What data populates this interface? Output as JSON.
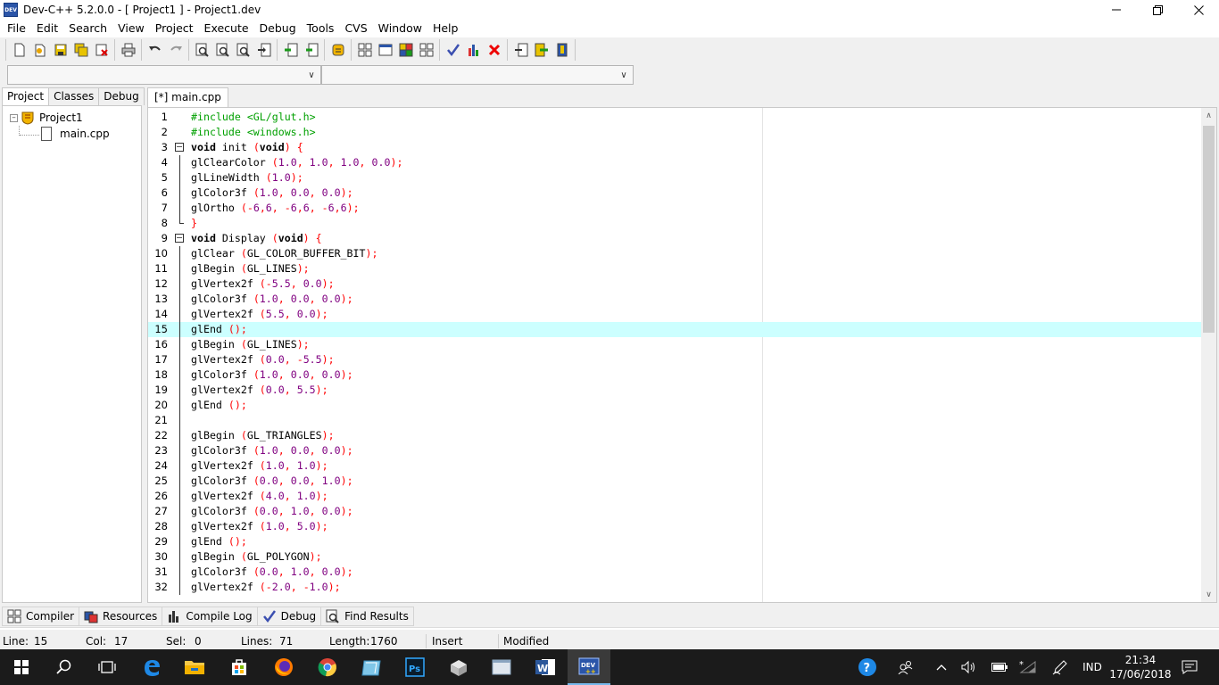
{
  "window": {
    "title": "Dev-C++ 5.2.0.0 - [ Project1 ] - Project1.dev",
    "app_icon_text": "DEV"
  },
  "menu": [
    "File",
    "Edit",
    "Search",
    "View",
    "Project",
    "Execute",
    "Debug",
    "Tools",
    "CVS",
    "Window",
    "Help"
  ],
  "left_panel": {
    "tabs": [
      "Project",
      "Classes",
      "Debug"
    ],
    "active_tab": "Project",
    "tree": {
      "project": "Project1",
      "files": [
        "main.cpp"
      ]
    }
  },
  "editor": {
    "tab_label": "[*] main.cpp",
    "current_line": 15,
    "lines": [
      {
        "n": "1",
        "text": "#include <GL/glut.h>"
      },
      {
        "n": "2",
        "text": "#include <windows.h>"
      },
      {
        "n": "3",
        "text": "void init (void) {"
      },
      {
        "n": "4",
        "text": "glClearColor (1.0, 1.0, 1.0, 0.0);"
      },
      {
        "n": "5",
        "text": "glLineWidth (1.0);"
      },
      {
        "n": "6",
        "text": "glColor3f (1.0, 0.0, 0.0);"
      },
      {
        "n": "7",
        "text": "glOrtho (-6,6, -6,6, -6,6);"
      },
      {
        "n": "8",
        "text": "}"
      },
      {
        "n": "9",
        "text": "void Display (void) {"
      },
      {
        "n": "10",
        "text": "glClear (GL_COLOR_BUFFER_BIT);"
      },
      {
        "n": "11",
        "text": "glBegin (GL_LINES);"
      },
      {
        "n": "12",
        "text": "glVertex2f (-5.5, 0.0);"
      },
      {
        "n": "13",
        "text": "glColor3f (1.0, 0.0, 0.0);"
      },
      {
        "n": "14",
        "text": "glVertex2f (5.5, 0.0);"
      },
      {
        "n": "15",
        "text": "glEnd ();"
      },
      {
        "n": "16",
        "text": "glBegin (GL_LINES);"
      },
      {
        "n": "17",
        "text": "glVertex2f (0.0, -5.5);"
      },
      {
        "n": "18",
        "text": "glColor3f (1.0, 0.0, 0.0);"
      },
      {
        "n": "19",
        "text": "glVertex2f (0.0, 5.5);"
      },
      {
        "n": "20",
        "text": "glEnd ();"
      },
      {
        "n": "21",
        "text": ""
      },
      {
        "n": "22",
        "text": "glBegin (GL_TRIANGLES);"
      },
      {
        "n": "23",
        "text": "glColor3f (1.0, 0.0, 0.0);"
      },
      {
        "n": "24",
        "text": "glVertex2f (1.0, 1.0);"
      },
      {
        "n": "25",
        "text": "glColor3f (0.0, 0.0, 1.0);"
      },
      {
        "n": "26",
        "text": "glVertex2f (4.0, 1.0);"
      },
      {
        "n": "27",
        "text": "glColor3f (0.0, 1.0, 0.0);"
      },
      {
        "n": "28",
        "text": "glVertex2f (1.0, 5.0);"
      },
      {
        "n": "29",
        "text": "glEnd ();"
      },
      {
        "n": "30",
        "text": "glBegin (GL_POLYGON);"
      },
      {
        "n": "31",
        "text": "glColor3f (0.0, 1.0, 0.0);"
      },
      {
        "n": "32",
        "text": "glVertex2f (-2.0, -1.0);"
      }
    ]
  },
  "bottom_tabs": [
    {
      "label": "Compiler",
      "icon": "compiler-icon"
    },
    {
      "label": "Resources",
      "icon": "resources-icon"
    },
    {
      "label": "Compile Log",
      "icon": "compile-log-icon"
    },
    {
      "label": "Debug",
      "icon": "debug-icon"
    },
    {
      "label": "Find Results",
      "icon": "find-results-icon"
    }
  ],
  "status": {
    "line_label": "Line:",
    "line_value": "15",
    "col_label": "Col:",
    "col_value": "17",
    "sel_label": "Sel:",
    "sel_value": "0",
    "lines_label": "Lines:",
    "lines_value": "71",
    "length_label": "Length:",
    "length_value": "1760",
    "mode": "Insert",
    "state": "Modified"
  },
  "taskbar": {
    "lang": "IND",
    "time": "21:34",
    "date": "17/06/2018"
  },
  "colors": {
    "current_line": "#ccffff",
    "preprocessor": "#00a000",
    "symbol": "#ff0000",
    "number": "#800080",
    "taskbar": "#1b1b1b"
  }
}
